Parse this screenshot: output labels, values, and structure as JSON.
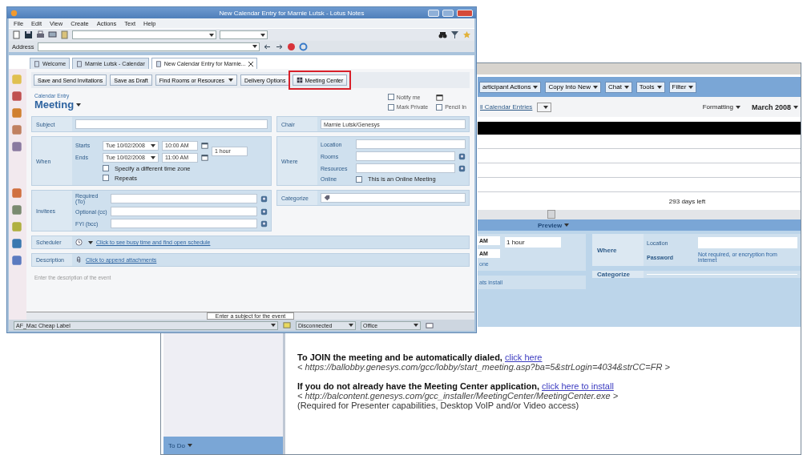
{
  "front_window": {
    "title": "New Calendar Entry for Marnie Lutsk - Lotus Notes",
    "menu": [
      "File",
      "Edit",
      "View",
      "Create",
      "Actions",
      "Text",
      "Help"
    ],
    "address_label": "Address",
    "tabs": [
      {
        "label": "Welcome",
        "selected": false
      },
      {
        "label": "Marnie Lutsk - Calendar",
        "selected": false
      },
      {
        "label": "New Calendar Entry for Marnie...",
        "selected": true
      }
    ],
    "actions": [
      {
        "label": "Save and Send Invitations",
        "kind": "plain",
        "highlighted": false
      },
      {
        "label": "Save as Draft",
        "kind": "plain",
        "highlighted": false
      },
      {
        "label": "Find Rooms or Resources",
        "kind": "dropdown",
        "highlighted": false
      },
      {
        "label": "Delivery Options",
        "kind": "plain",
        "highlighted": false
      },
      {
        "label": "Meeting Center",
        "kind": "icon",
        "highlighted": true
      }
    ],
    "form_type": "Calendar Entry",
    "form_title": "Meeting",
    "options": [
      {
        "label": "Notify me",
        "checked": false
      },
      {
        "label": "Mark Private",
        "checked": false
      },
      {
        "label": "Pencil In",
        "checked": false
      }
    ],
    "subject_label": "Subject",
    "when": {
      "label": "When",
      "starts_label": "Starts",
      "starts_date": "Tue 10/02/2008",
      "starts_time": "10:00 AM",
      "ends_label": "Ends",
      "ends_date": "Tue 10/02/2008",
      "ends_time": "11:00 AM",
      "duration": "1 hour",
      "options": [
        {
          "label": "Specify a different time zone",
          "checked": false
        },
        {
          "label": "Repeats",
          "checked": false
        }
      ]
    },
    "chair": {
      "label": "Chair",
      "value": "Marnie Lutsk/Genesys"
    },
    "where": {
      "label": "Where",
      "fields": [
        {
          "label": "Location",
          "kind": "text"
        },
        {
          "label": "Rooms",
          "kind": "lookup"
        },
        {
          "label": "Resources",
          "kind": "lookup"
        }
      ],
      "online_label": "Online",
      "online": {
        "label": "This is an Online Meeting",
        "checked": false
      }
    },
    "invitees": {
      "label": "Invitees",
      "fields": [
        "Required (To)",
        "Optional (cc)",
        "FYI (bcc)"
      ]
    },
    "categorize_label": "Categorize",
    "scheduler": {
      "label": "Scheduler",
      "link": "Click to see busy time and find open schedule"
    },
    "description": {
      "label": "Description",
      "link": "Click to append attachments",
      "placeholder": "Enter the description of the event"
    },
    "hint": "Enter a subject for the event",
    "status": {
      "location": "AF_Mac Cheap Label",
      "connection": "Disconnected",
      "place": "Office"
    }
  },
  "back_window": {
    "actions": [
      "articipant Actions",
      "Copy Into New",
      "Chat",
      "Tools",
      "Filter"
    ],
    "view": "ll Calendar Entries",
    "formatting": "Formatting",
    "month": "March 2008",
    "days_left": "293 days left",
    "preview": "Preview",
    "times": [
      "AM",
      "AM"
    ],
    "duration": "1 hour",
    "zone": "one",
    "repeats": "ats install",
    "where": {
      "label": "Where",
      "location_label": "Location",
      "password_label": "Password",
      "password_note": "Not required, or encryption from internet"
    },
    "categorize_label": "Categorize",
    "sidebar_footer": "To Do",
    "body": [
      {
        "text": "To JOIN the meeting and be automatically dialed, ",
        "link": "click here",
        "url": "< https://ballobby.genesys.com/gcc/lobby/start_meeting.asp?ba=5&strLogin=4034&strCC=FR >"
      },
      {
        "text": "If you do not already have the Meeting Center application, ",
        "link": "click here to install",
        "url": "< http://balcontent.genesys.com/gcc_installer/MeetingCenter/MeetingCenter.exe >",
        "note": "(Required for Presenter capabilities, Desktop VoIP and/or Video access)"
      }
    ]
  }
}
